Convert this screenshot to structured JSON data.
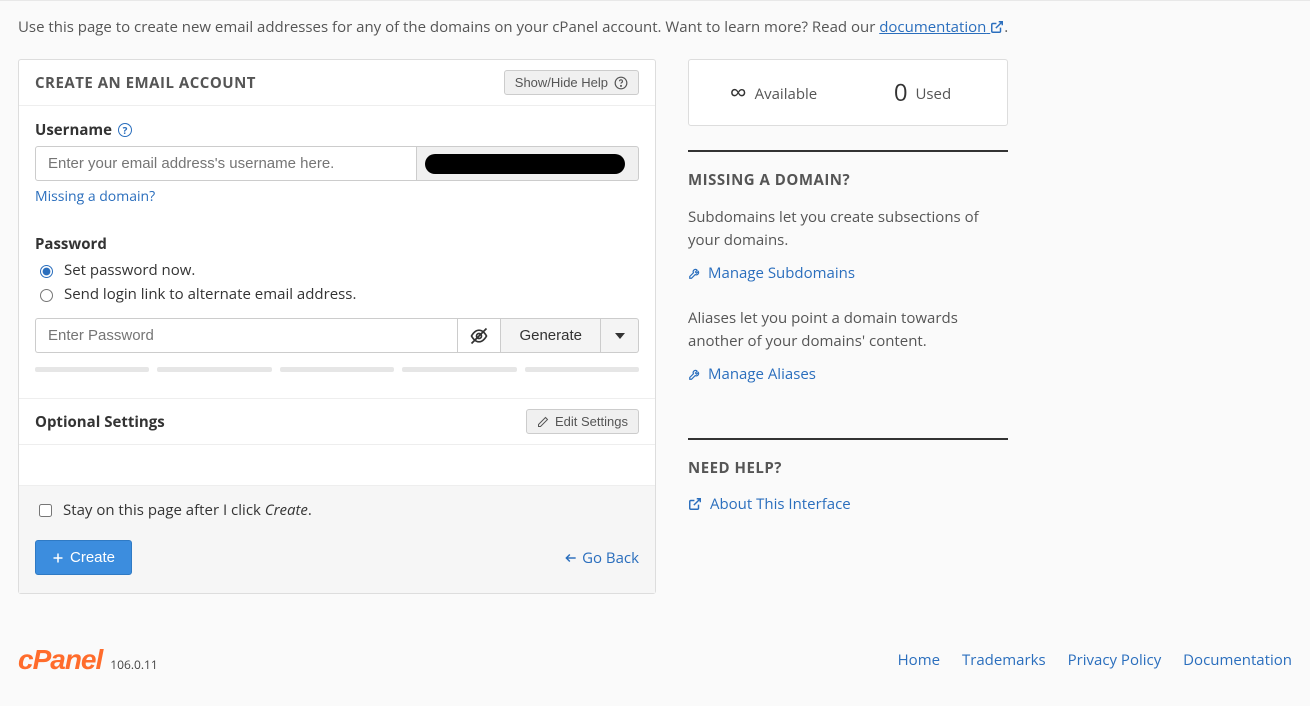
{
  "intro": {
    "text_before": "Use this page to create new email addresses for any of the domains on your cPanel account. Want to learn more? Read our ",
    "doc_link": "documentation",
    "text_after": "."
  },
  "panel": {
    "title": "CREATE AN EMAIL ACCOUNT",
    "showhide": "Show/Hide Help",
    "username_label": "Username",
    "username_placeholder": "Enter your email address's username here.",
    "missing_domain": "Missing a domain?",
    "password_label": "Password",
    "radio_now": "Set password now.",
    "radio_link": "Send login link to alternate email address.",
    "password_placeholder": "Enter Password",
    "generate": "Generate",
    "optional_title": "Optional Settings",
    "edit_settings": "Edit Settings",
    "stay_text_before": "Stay on this page after I click ",
    "stay_text_em": "Create",
    "stay_text_after": ".",
    "create_btn": "Create",
    "goback": "Go Back"
  },
  "side": {
    "available_symbol": "∞",
    "available_label": "Available",
    "used_value": "0",
    "used_label": "Used",
    "missing_title": "MISSING A DOMAIN?",
    "sub_text": "Subdomains let you create subsections of your domains.",
    "manage_sub": "Manage Subdomains",
    "alias_text": "Aliases let you point a domain towards another of your domains' content.",
    "manage_alias": "Manage Aliases",
    "help_title": "NEED HELP?",
    "about": "About This Interface"
  },
  "footer": {
    "version": "106.0.11",
    "links": [
      "Home",
      "Trademarks",
      "Privacy Policy",
      "Documentation"
    ]
  }
}
